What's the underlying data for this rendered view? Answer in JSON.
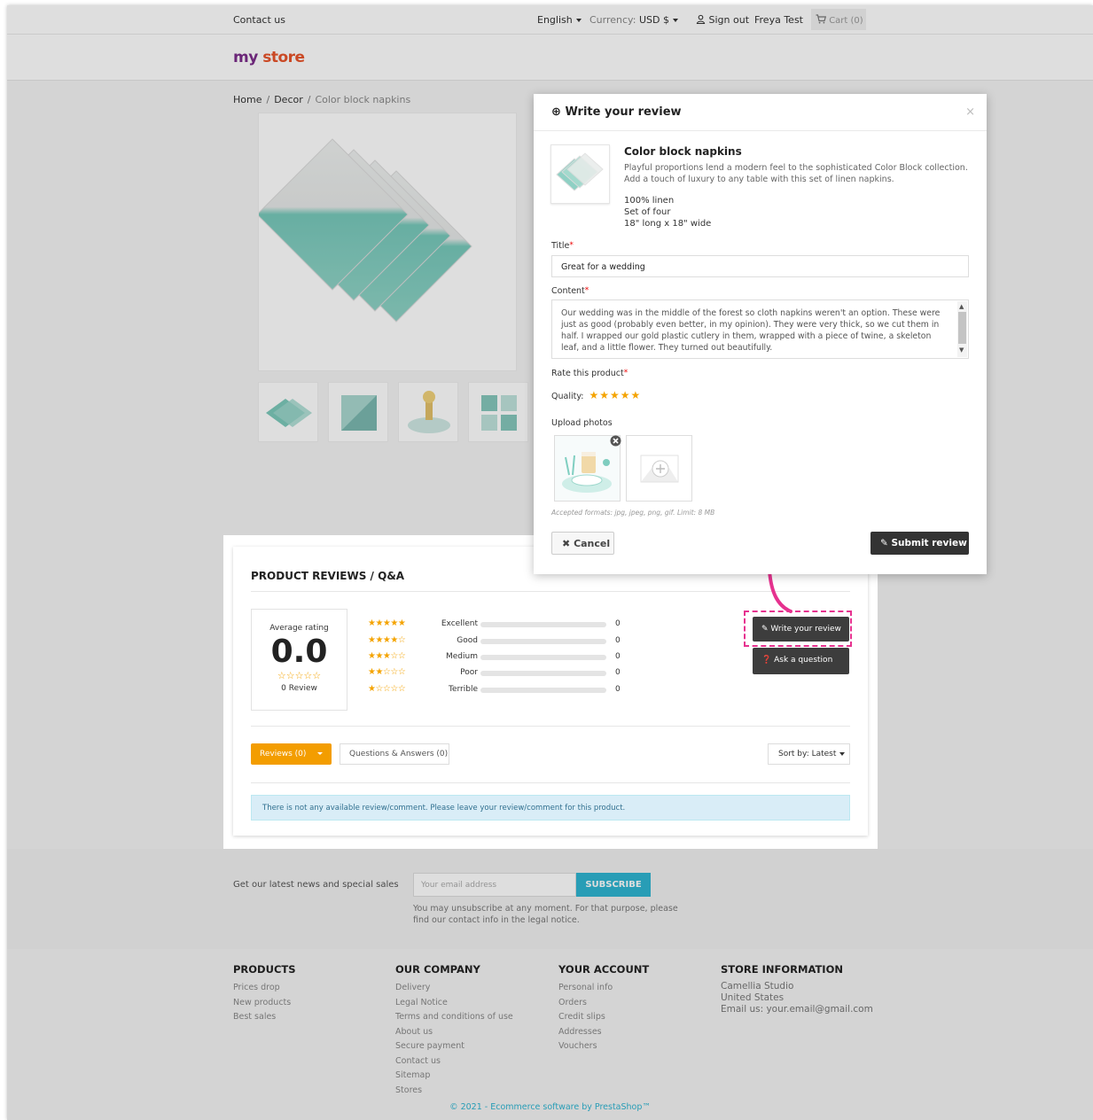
{
  "header": {
    "contact": "Contact us",
    "language": "English",
    "currency_label": "Currency:",
    "currency_value": "USD $",
    "sign_out": "Sign out",
    "user": "Freya Test",
    "cart": "Cart (0)"
  },
  "logo": {
    "part1": "my",
    "part2": "store"
  },
  "breadcrumb": {
    "home": "Home",
    "sep": "/",
    "category": "Decor",
    "current": "Color block napkins"
  },
  "reviews": {
    "title": "PRODUCT REVIEWS / Q&A",
    "average_label": "Average rating",
    "average_value": "0.0",
    "empty_stars": "☆☆☆☆☆",
    "review_count": "0 Review",
    "rows": [
      {
        "stars": "★★★★★",
        "name": "Excellent",
        "count": "0"
      },
      {
        "stars": "★★★★☆",
        "name": "Good",
        "count": "0"
      },
      {
        "stars": "★★★☆☆",
        "name": "Medium",
        "count": "0"
      },
      {
        "stars": "★★☆☆☆",
        "name": "Poor",
        "count": "0"
      },
      {
        "stars": "★☆☆☆☆",
        "name": "Terrible",
        "count": "0"
      }
    ],
    "write_review": "Write your review",
    "ask_question": "Ask a question",
    "tab_reviews": "Reviews (0)",
    "tab_questions": "Questions & Answers (0)",
    "sort_label": "Sort by: Latest",
    "empty_notice": "There is not any available review/comment. Please leave your review/comment for this product."
  },
  "newsletter": {
    "text": "Get our latest news and special sales",
    "placeholder": "Your email address",
    "subscribe": "SUBSCRIBE",
    "note": "You may unsubscribe at any moment. For that purpose, please find our contact info in the legal notice."
  },
  "footer": {
    "products": {
      "heading": "PRODUCTS",
      "links": [
        "Prices drop",
        "New products",
        "Best sales"
      ]
    },
    "company": {
      "heading": "OUR COMPANY",
      "links": [
        "Delivery",
        "Legal Notice",
        "Terms and conditions of use",
        "About us",
        "Secure payment",
        "Contact us",
        "Sitemap",
        "Stores"
      ]
    },
    "account": {
      "heading": "YOUR ACCOUNT",
      "links": [
        "Personal info",
        "Orders",
        "Credit slips",
        "Addresses",
        "Vouchers"
      ]
    },
    "store": {
      "heading": "STORE INFORMATION",
      "lines": [
        "Camellia Studio",
        "United States",
        "Email us: your.email@gmail.com"
      ]
    },
    "copyright": "© 2021 - Ecommerce software by PrestaShop™"
  },
  "modal": {
    "title": "Write your review",
    "close": "×",
    "product_name": "Color block napkins",
    "product_desc": "Playful proportions lend a modern feel to the sophisticated Color Block collection. Add a touch of luxury to any table with this set of linen napkins.",
    "specs": [
      "100% linen",
      "Set of four",
      "18\" long x 18\" wide"
    ],
    "title_label": "Title",
    "title_value": "Great for a wedding",
    "content_label": "Content",
    "content_value": "Our wedding was in the middle of the forest so cloth napkins weren't an option. These were just as good (probably even better, in my opinion). They were very thick, so we cut them in half. I wrapped our gold plastic cutlery in them, wrapped with a piece of twine, a skeleton leaf, and a little flower. They turned out beautifully.",
    "rate_label": "Rate this product",
    "quality_label": "Quality:",
    "quality_stars": "★★★★★",
    "upload_label": "Upload photos",
    "accepted": "Accepted formats: jpg, jpeg, png, gif. Limit: 8 MB",
    "cancel": "Cancel",
    "submit": "Submit review",
    "required_mark": "*"
  },
  "colors": {
    "accent_pink": "#e6328f",
    "orange": "#f39d00",
    "teal": "#2fb5d2",
    "star": "#f4a300"
  }
}
